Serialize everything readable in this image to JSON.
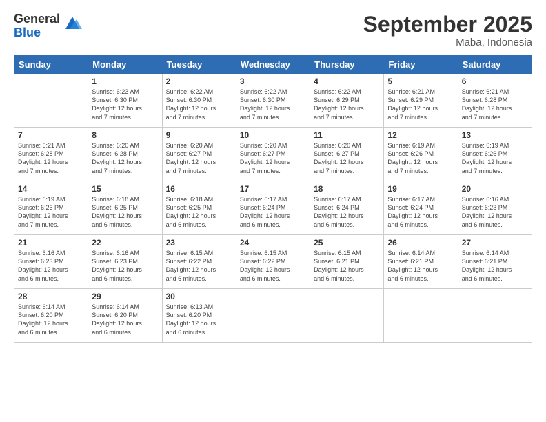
{
  "logo": {
    "general": "General",
    "blue": "Blue"
  },
  "header": {
    "month": "September 2025",
    "location": "Maba, Indonesia"
  },
  "weekdays": [
    "Sunday",
    "Monday",
    "Tuesday",
    "Wednesday",
    "Thursday",
    "Friday",
    "Saturday"
  ],
  "weeks": [
    [
      {
        "day": "",
        "info": ""
      },
      {
        "day": "1",
        "info": "Sunrise: 6:23 AM\nSunset: 6:30 PM\nDaylight: 12 hours\nand 7 minutes."
      },
      {
        "day": "2",
        "info": "Sunrise: 6:22 AM\nSunset: 6:30 PM\nDaylight: 12 hours\nand 7 minutes."
      },
      {
        "day": "3",
        "info": "Sunrise: 6:22 AM\nSunset: 6:30 PM\nDaylight: 12 hours\nand 7 minutes."
      },
      {
        "day": "4",
        "info": "Sunrise: 6:22 AM\nSunset: 6:29 PM\nDaylight: 12 hours\nand 7 minutes."
      },
      {
        "day": "5",
        "info": "Sunrise: 6:21 AM\nSunset: 6:29 PM\nDaylight: 12 hours\nand 7 minutes."
      },
      {
        "day": "6",
        "info": "Sunrise: 6:21 AM\nSunset: 6:28 PM\nDaylight: 12 hours\nand 7 minutes."
      }
    ],
    [
      {
        "day": "7",
        "info": "Sunrise: 6:21 AM\nSunset: 6:28 PM\nDaylight: 12 hours\nand 7 minutes."
      },
      {
        "day": "8",
        "info": "Sunrise: 6:20 AM\nSunset: 6:28 PM\nDaylight: 12 hours\nand 7 minutes."
      },
      {
        "day": "9",
        "info": "Sunrise: 6:20 AM\nSunset: 6:27 PM\nDaylight: 12 hours\nand 7 minutes."
      },
      {
        "day": "10",
        "info": "Sunrise: 6:20 AM\nSunset: 6:27 PM\nDaylight: 12 hours\nand 7 minutes."
      },
      {
        "day": "11",
        "info": "Sunrise: 6:20 AM\nSunset: 6:27 PM\nDaylight: 12 hours\nand 7 minutes."
      },
      {
        "day": "12",
        "info": "Sunrise: 6:19 AM\nSunset: 6:26 PM\nDaylight: 12 hours\nand 7 minutes."
      },
      {
        "day": "13",
        "info": "Sunrise: 6:19 AM\nSunset: 6:26 PM\nDaylight: 12 hours\nand 7 minutes."
      }
    ],
    [
      {
        "day": "14",
        "info": "Sunrise: 6:19 AM\nSunset: 6:26 PM\nDaylight: 12 hours\nand 7 minutes."
      },
      {
        "day": "15",
        "info": "Sunrise: 6:18 AM\nSunset: 6:25 PM\nDaylight: 12 hours\nand 6 minutes."
      },
      {
        "day": "16",
        "info": "Sunrise: 6:18 AM\nSunset: 6:25 PM\nDaylight: 12 hours\nand 6 minutes."
      },
      {
        "day": "17",
        "info": "Sunrise: 6:17 AM\nSunset: 6:24 PM\nDaylight: 12 hours\nand 6 minutes."
      },
      {
        "day": "18",
        "info": "Sunrise: 6:17 AM\nSunset: 6:24 PM\nDaylight: 12 hours\nand 6 minutes."
      },
      {
        "day": "19",
        "info": "Sunrise: 6:17 AM\nSunset: 6:24 PM\nDaylight: 12 hours\nand 6 minutes."
      },
      {
        "day": "20",
        "info": "Sunrise: 6:16 AM\nSunset: 6:23 PM\nDaylight: 12 hours\nand 6 minutes."
      }
    ],
    [
      {
        "day": "21",
        "info": "Sunrise: 6:16 AM\nSunset: 6:23 PM\nDaylight: 12 hours\nand 6 minutes."
      },
      {
        "day": "22",
        "info": "Sunrise: 6:16 AM\nSunset: 6:23 PM\nDaylight: 12 hours\nand 6 minutes."
      },
      {
        "day": "23",
        "info": "Sunrise: 6:15 AM\nSunset: 6:22 PM\nDaylight: 12 hours\nand 6 minutes."
      },
      {
        "day": "24",
        "info": "Sunrise: 6:15 AM\nSunset: 6:22 PM\nDaylight: 12 hours\nand 6 minutes."
      },
      {
        "day": "25",
        "info": "Sunrise: 6:15 AM\nSunset: 6:21 PM\nDaylight: 12 hours\nand 6 minutes."
      },
      {
        "day": "26",
        "info": "Sunrise: 6:14 AM\nSunset: 6:21 PM\nDaylight: 12 hours\nand 6 minutes."
      },
      {
        "day": "27",
        "info": "Sunrise: 6:14 AM\nSunset: 6:21 PM\nDaylight: 12 hours\nand 6 minutes."
      }
    ],
    [
      {
        "day": "28",
        "info": "Sunrise: 6:14 AM\nSunset: 6:20 PM\nDaylight: 12 hours\nand 6 minutes."
      },
      {
        "day": "29",
        "info": "Sunrise: 6:14 AM\nSunset: 6:20 PM\nDaylight: 12 hours\nand 6 minutes."
      },
      {
        "day": "30",
        "info": "Sunrise: 6:13 AM\nSunset: 6:20 PM\nDaylight: 12 hours\nand 6 minutes."
      },
      {
        "day": "",
        "info": ""
      },
      {
        "day": "",
        "info": ""
      },
      {
        "day": "",
        "info": ""
      },
      {
        "day": "",
        "info": ""
      }
    ]
  ]
}
